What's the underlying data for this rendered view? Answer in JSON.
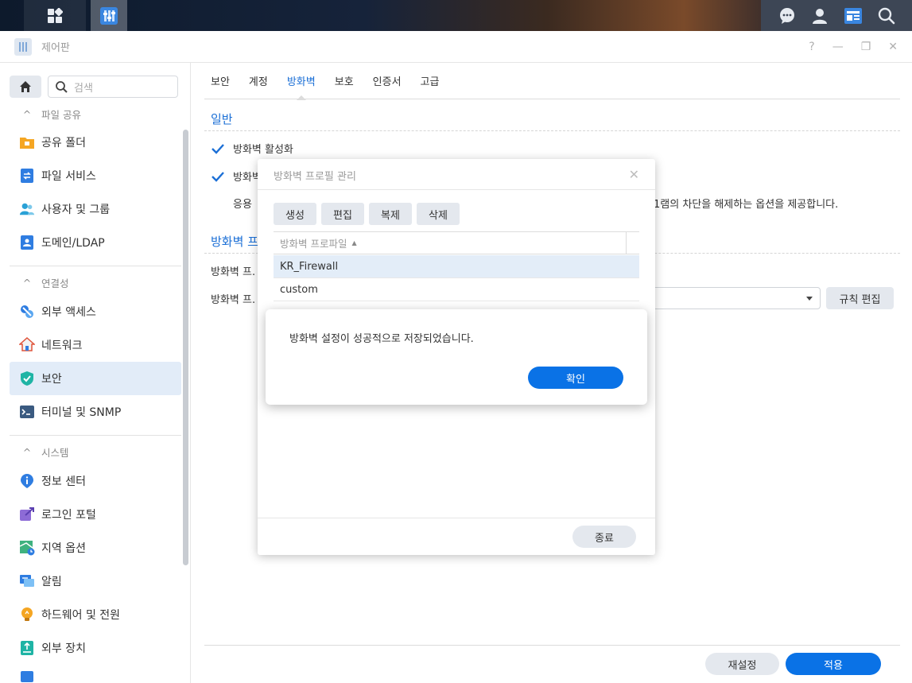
{
  "window": {
    "title": "제어판"
  },
  "sidebar": {
    "search_placeholder": "검색",
    "groups": [
      {
        "label": "파일 공유"
      },
      {
        "label": "연결성"
      },
      {
        "label": "시스템"
      }
    ],
    "items": [
      {
        "label": "공유 폴더"
      },
      {
        "label": "파일 서비스"
      },
      {
        "label": "사용자 및 그룹"
      },
      {
        "label": "도메인/LDAP"
      },
      {
        "label": "외부 액세스"
      },
      {
        "label": "네트워크"
      },
      {
        "label": "보안"
      },
      {
        "label": "터미널 및 SNMP"
      },
      {
        "label": "정보 센터"
      },
      {
        "label": "로그인 포털"
      },
      {
        "label": "지역 옵션"
      },
      {
        "label": "알림"
      },
      {
        "label": "하드웨어 및 전원"
      },
      {
        "label": "외부 장치"
      }
    ]
  },
  "tabs": [
    "보안",
    "계정",
    "방화벽",
    "보호",
    "인증서",
    "고급"
  ],
  "main": {
    "section_general": "일반",
    "enable_firewall": "방화벽 활성화",
    "option2_prefix": "방화벽",
    "desc_prefix": "응용",
    "desc_suffix": "1램의 차단을 해제하는 옵션을 제공합니다.",
    "section_profile_prefix": "방화벽 프",
    "row1_prefix": "방화벽 프.",
    "row2_prefix": "방화벽 프.",
    "edit_rules": "규칙 편집",
    "reset": "재설정",
    "apply": "적용"
  },
  "dialog": {
    "title": "방화벽 프로필 관리",
    "buttons": {
      "create": "생성",
      "edit": "편집",
      "copy": "복제",
      "delete": "삭제"
    },
    "column": "방화벽 프로파일",
    "rows": [
      "KR_Firewall",
      "custom"
    ],
    "close": "종료"
  },
  "alert": {
    "message": "방화벽 설정이 성공적으로 저장되었습니다.",
    "ok": "확인"
  },
  "colors": {
    "accent": "#1b6fd6",
    "primary_button": "#0a72e6",
    "active_item": "#e2ecf8"
  }
}
